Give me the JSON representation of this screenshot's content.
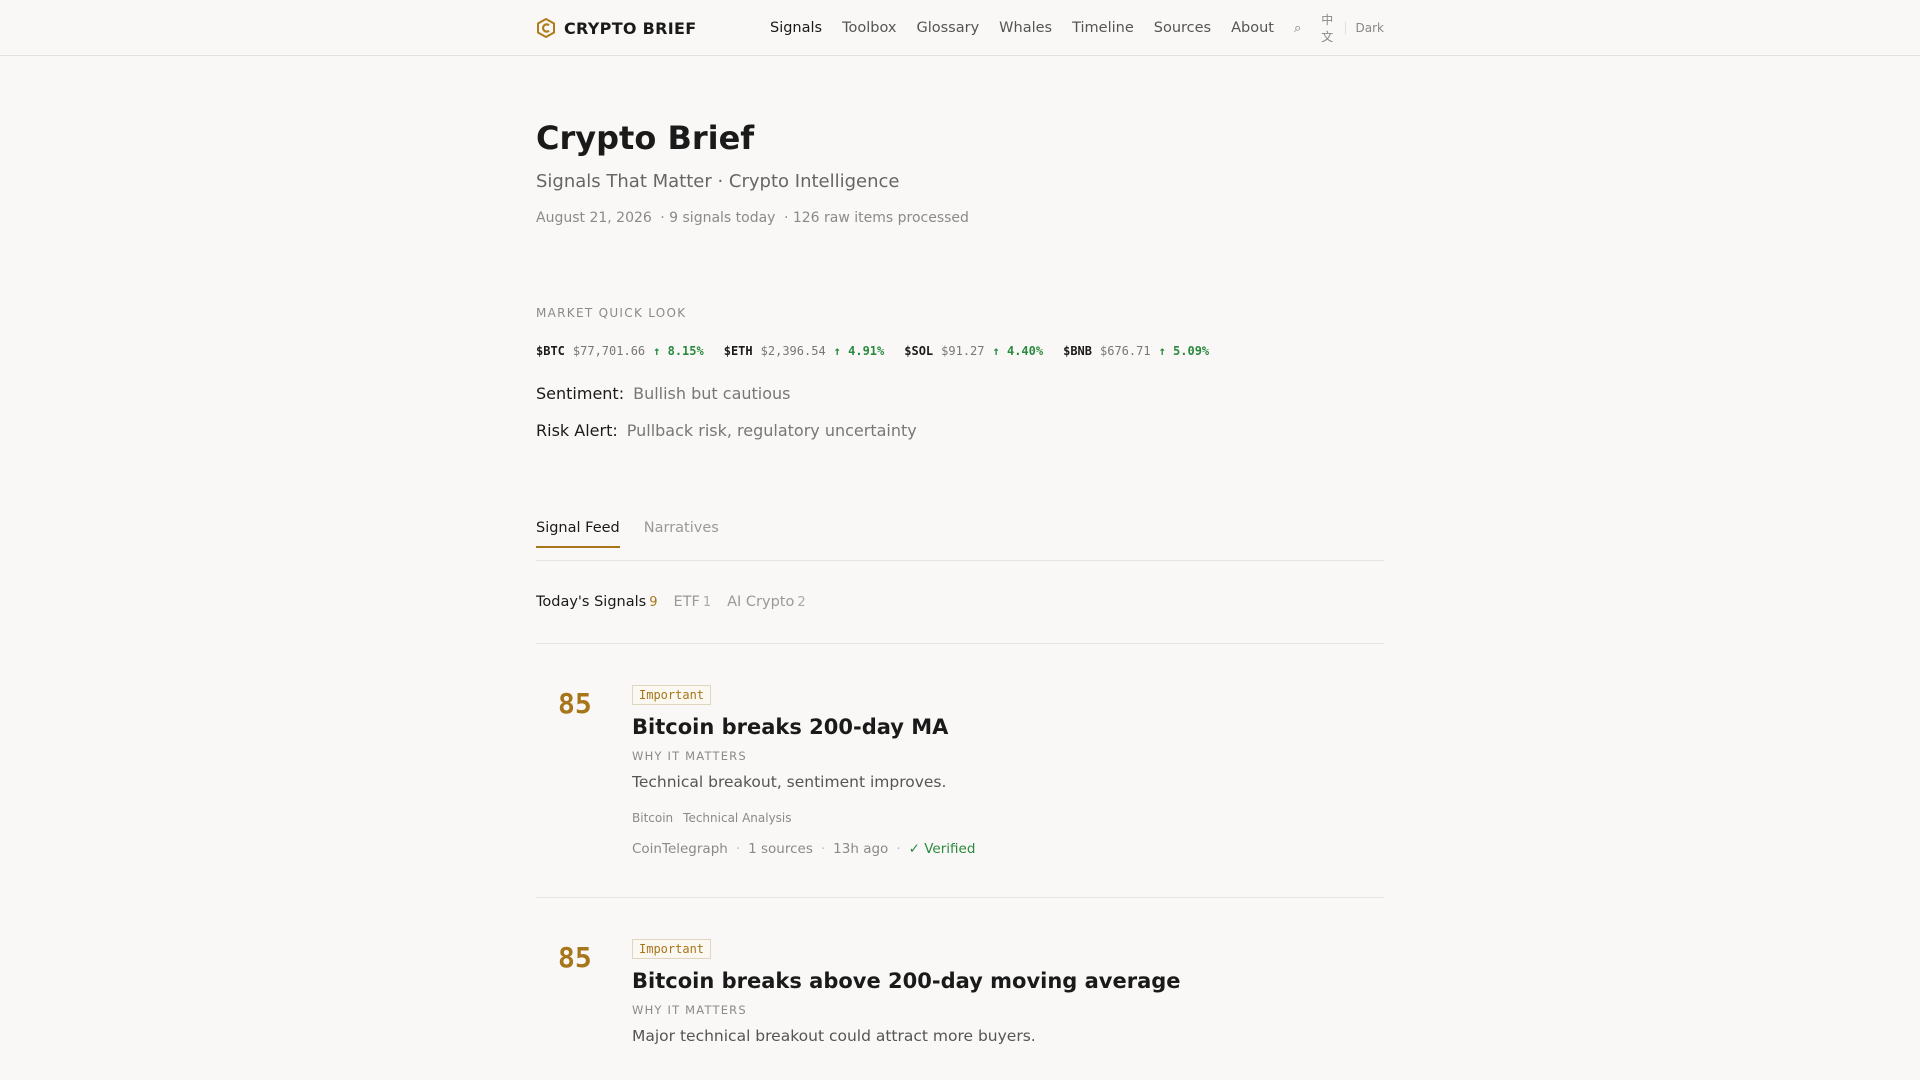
{
  "header": {
    "brand": "CRYPTO BRIEF",
    "nav": [
      "Signals",
      "Toolbox",
      "Glossary",
      "Whales",
      "Timeline",
      "Sources",
      "About"
    ],
    "lang": "中文",
    "theme": "Dark"
  },
  "hero": {
    "title": "Crypto Brief",
    "subtitle": "Signals That Matter · Crypto Intelligence",
    "date": "August 21, 2026",
    "signals_today": "· 9 signals today",
    "raw_items": "· 126 raw items processed"
  },
  "market": {
    "label": "MARKET QUICK LOOK",
    "tickers": [
      {
        "sym": "$BTC",
        "price": "$77,701.66",
        "chg": "↑ 8.15%"
      },
      {
        "sym": "$ETH",
        "price": "$2,396.54",
        "chg": "↑ 4.91%"
      },
      {
        "sym": "$SOL",
        "price": "$91.27",
        "chg": "↑ 4.40%"
      },
      {
        "sym": "$BNB",
        "price": "$676.71",
        "chg": "↑ 5.09%"
      }
    ],
    "sentiment_label": "Sentiment:",
    "sentiment_value": "Bullish but cautious",
    "risk_label": "Risk Alert:",
    "risk_value": "Pullback risk, regulatory uncertainty"
  },
  "tabs": [
    "Signal Feed",
    "Narratives"
  ],
  "filters": [
    {
      "label": "Today's Signals",
      "count": "9"
    },
    {
      "label": "ETF",
      "count": "1"
    },
    {
      "label": "AI Crypto",
      "count": "2"
    }
  ],
  "signals": [
    {
      "score": "85",
      "badge": "Important",
      "title": "Bitcoin breaks 200-day MA",
      "why_label": "WHY IT MATTERS",
      "desc": "Technical breakout, sentiment improves.",
      "tags": [
        "Bitcoin",
        "Technical Analysis"
      ],
      "source": "CoinTelegraph",
      "sources_count": "1 sources",
      "time": "13h ago",
      "verified": "✓ Verified"
    },
    {
      "score": "85",
      "badge": "Important",
      "title": "Bitcoin breaks above 200-day moving average",
      "why_label": "WHY IT MATTERS",
      "desc": "Major technical breakout could attract more buyers."
    }
  ]
}
